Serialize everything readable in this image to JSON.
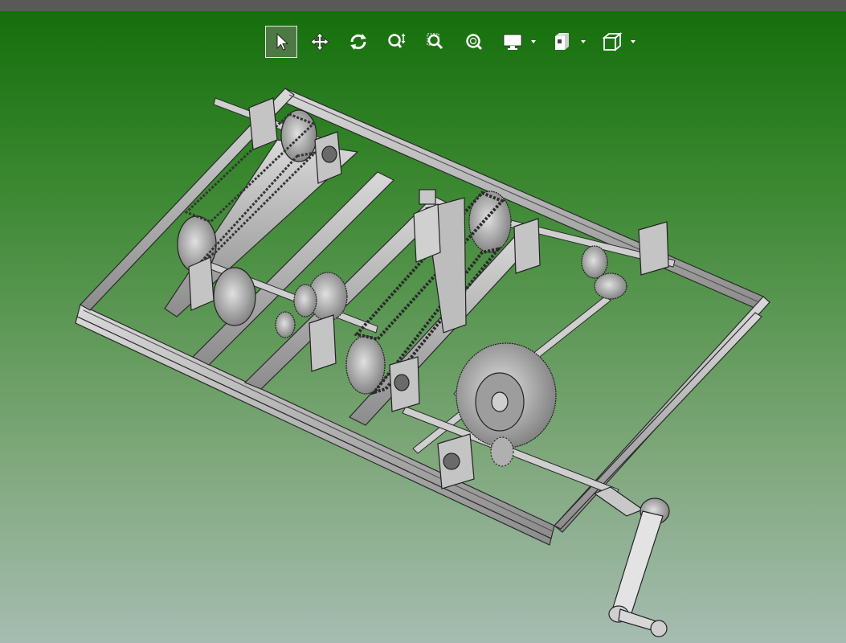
{
  "window": {
    "title_bar_color": "#595959"
  },
  "viewport": {
    "background_top": "#156f0b",
    "background_bottom": "#a6bcb2"
  },
  "toolbar": {
    "tools": [
      {
        "id": "select",
        "icon": "select-arrow-icon",
        "active": true
      },
      {
        "id": "pan",
        "icon": "pan-move-icon",
        "active": false
      },
      {
        "id": "rotate",
        "icon": "rotate-icon",
        "active": false
      },
      {
        "id": "zoom",
        "icon": "zoom-updown-icon",
        "active": false
      },
      {
        "id": "zoom-window",
        "icon": "zoom-window-icon",
        "active": false
      },
      {
        "id": "zoom-fit",
        "icon": "zoom-fit-icon",
        "active": false
      },
      {
        "id": "display-style",
        "icon": "monitor-icon",
        "has_dropdown": true
      },
      {
        "id": "view-orientation",
        "icon": "view-orientation-icon",
        "has_dropdown": true
      },
      {
        "id": "standard-views",
        "icon": "cube-icon",
        "has_dropdown": true
      }
    ]
  },
  "model": {
    "description_visible": false,
    "colors": {
      "metal": "#b5b5b5",
      "edge": "#2e2e2e",
      "shade": "#8a8a8a",
      "light": "#d6d6d6"
    }
  }
}
